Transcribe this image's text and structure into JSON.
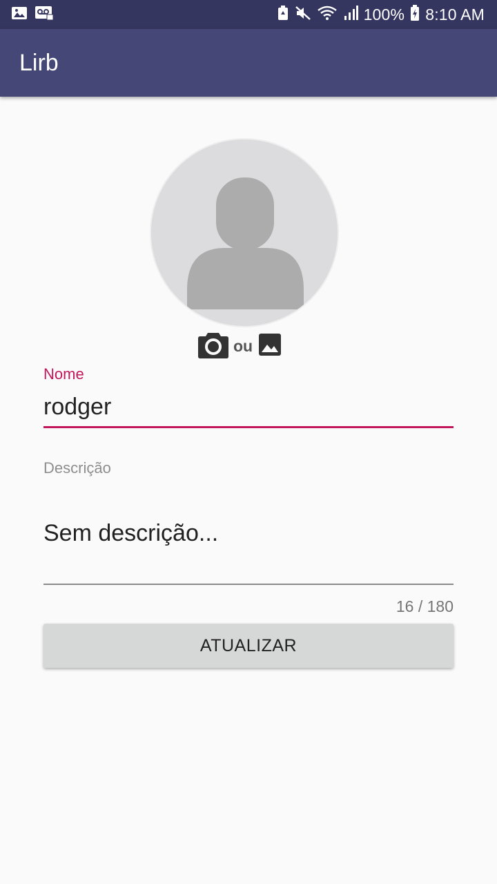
{
  "status_bar": {
    "battery": "100%",
    "time": "8:10 AM",
    "icons": [
      "image-notification-icon",
      "voicemail-icon",
      "recycle-icon",
      "mute-icon",
      "wifi-icon",
      "signal-icon",
      "battery-charging-icon"
    ]
  },
  "app_bar": {
    "title": "Lirb"
  },
  "profile": {
    "avatar_icon": "person-placeholder-icon",
    "camera_icon": "camera-icon",
    "or_text": "ou",
    "gallery_icon": "gallery-icon"
  },
  "form": {
    "name_label": "Nome",
    "name_value": "rodger",
    "description_label": "Descrição",
    "description_value": "Sem descrição...",
    "counter": "16 / 180",
    "submit_label": "ATUALIZAR"
  },
  "colors": {
    "status_bar": "#353660",
    "app_bar": "#454776",
    "accent": "#c2185b",
    "button": "#d6d7d7"
  }
}
